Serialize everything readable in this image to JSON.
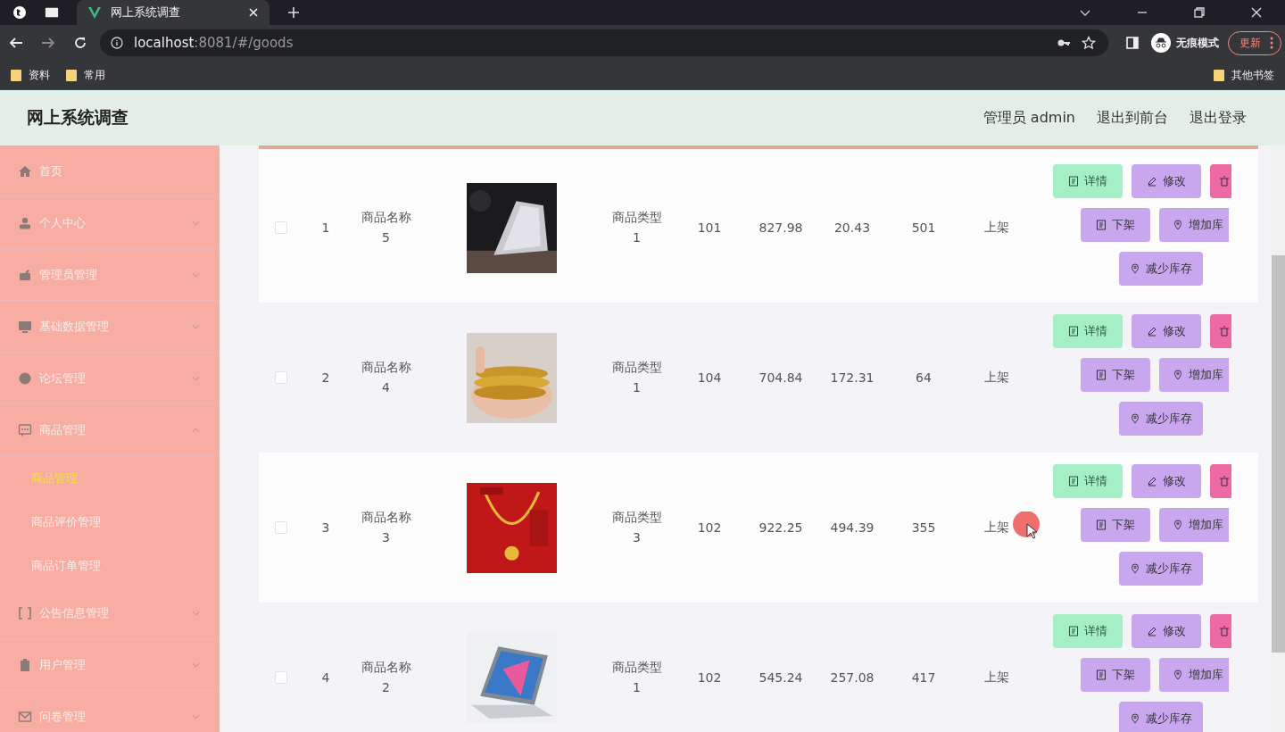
{
  "browser": {
    "tab_title": "网上系统调查",
    "url_host": "localhost",
    "url_rest": ":8081/#/goods",
    "incognito_label": "无痕模式",
    "update_label": "更新",
    "bookmarks": [
      "资料",
      "常用"
    ],
    "other_bookmarks": "其他书签"
  },
  "header": {
    "title": "网上系统调查",
    "links": [
      "管理员 admin",
      "退出到前台",
      "退出登录"
    ]
  },
  "sidebar": {
    "items": [
      {
        "label": "首页",
        "kind": "link"
      },
      {
        "label": "个人中心",
        "kind": "menu",
        "expanded": false
      },
      {
        "label": "管理员管理",
        "kind": "menu",
        "expanded": false
      },
      {
        "label": "基础数据管理",
        "kind": "menu",
        "expanded": false
      },
      {
        "label": "论坛管理",
        "kind": "menu",
        "expanded": false
      },
      {
        "label": "商品管理",
        "kind": "menu",
        "expanded": true,
        "children": [
          {
            "label": "商品管理",
            "selected": true
          },
          {
            "label": "商品评价管理",
            "selected": false
          },
          {
            "label": "商品订单管理",
            "selected": false
          }
        ]
      },
      {
        "label": "公告信息管理",
        "kind": "menu",
        "expanded": false
      },
      {
        "label": "用户管理",
        "kind": "menu",
        "expanded": false
      },
      {
        "label": "问卷管理",
        "kind": "menu",
        "expanded": false
      }
    ]
  },
  "table": {
    "rows": [
      {
        "checked": false,
        "index": "1",
        "name": "商品名称5",
        "type": "商品类型1",
        "column_6": "101",
        "price": "827.98",
        "column_8": "20.43",
        "column_9": "501",
        "status": "上架",
        "actions": {
          "details": "详情",
          "edit": "修改",
          "off_shelf": "下架",
          "add_stock": "增加库",
          "reduce_stock": "减少库存"
        }
      },
      {
        "checked": false,
        "index": "2",
        "name": "商品名称4",
        "type": "商品类型1",
        "column_6": "104",
        "price": "704.84",
        "column_8": "172.31",
        "column_9": "64",
        "status": "上架",
        "actions": {
          "details": "详情",
          "edit": "修改",
          "off_shelf": "下架",
          "add_stock": "增加库",
          "reduce_stock": "减少库存"
        }
      },
      {
        "checked": false,
        "index": "3",
        "name": "商品名称3",
        "type": "商品类型3",
        "column_6": "102",
        "price": "922.25",
        "column_8": "494.39",
        "column_9": "355",
        "status": "上架",
        "actions": {
          "details": "详情",
          "edit": "修改",
          "off_shelf": "下架",
          "add_stock": "增加库",
          "reduce_stock": "减少库存"
        }
      },
      {
        "checked": false,
        "index": "4",
        "name": "商品名称2",
        "type": "商品类型1",
        "column_6": "102",
        "price": "545.24",
        "column_8": "257.08",
        "column_9": "417",
        "status": "上架",
        "actions": {
          "details": "详情",
          "edit": "修改",
          "off_shelf": "下架",
          "add_stock": "增加库",
          "reduce_stock": "减少库存"
        }
      }
    ]
  }
}
